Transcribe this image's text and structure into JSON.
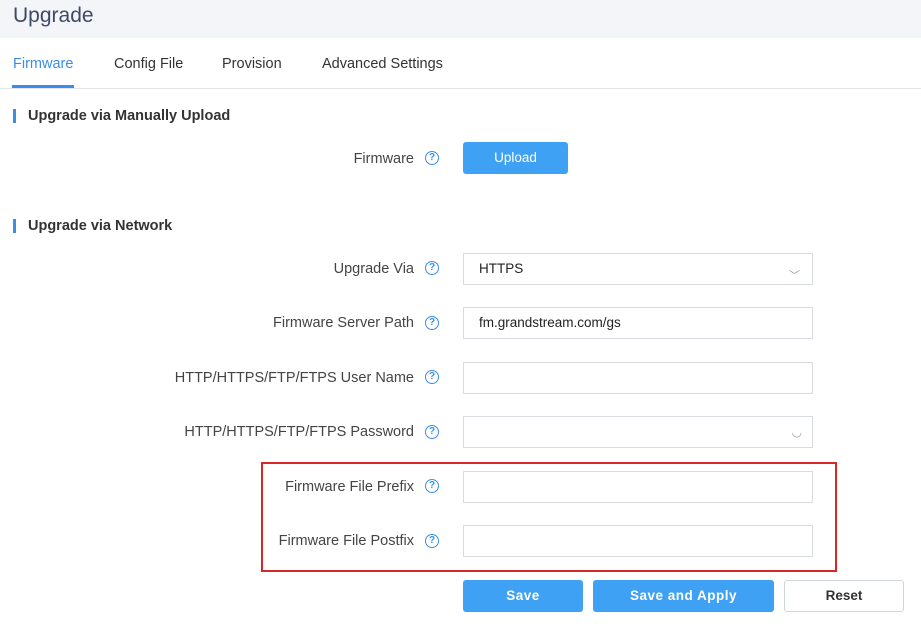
{
  "page": {
    "title": "Upgrade"
  },
  "tabs": [
    {
      "label": "Firmware",
      "active": true
    },
    {
      "label": "Config File",
      "active": false
    },
    {
      "label": "Provision",
      "active": false
    },
    {
      "label": "Advanced Settings",
      "active": false
    }
  ],
  "manual": {
    "section_title": "Upgrade via Manually Upload",
    "firmware_label": "Firmware",
    "upload_button": "Upload"
  },
  "network": {
    "section_title": "Upgrade via Network",
    "upgrade_via": {
      "label": "Upgrade Via",
      "value": "HTTPS"
    },
    "server_path": {
      "label": "Firmware Server Path",
      "value": "fm.grandstream.com/gs"
    },
    "user_name": {
      "label": "HTTP/HTTPS/FTP/FTPS User Name",
      "value": ""
    },
    "password": {
      "label": "HTTP/HTTPS/FTP/FTPS Password",
      "value": ""
    },
    "file_prefix": {
      "label": "Firmware File Prefix",
      "value": ""
    },
    "file_postfix": {
      "label": "Firmware File Postfix",
      "value": ""
    }
  },
  "actions": {
    "save": "Save",
    "save_apply": "Save and Apply",
    "reset": "Reset"
  },
  "icons": {
    "help": "?",
    "chevron": "﹀",
    "eye_closed": "◡"
  },
  "colors": {
    "accent": "#3a8ee6",
    "button": "#3fa1f3",
    "highlight": "#d9262b"
  }
}
